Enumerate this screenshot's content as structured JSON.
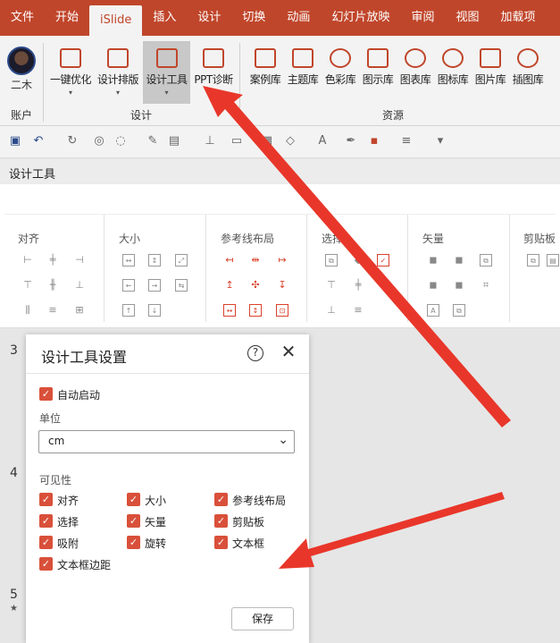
{
  "tabs": [
    "文件",
    "开始",
    "iSlide",
    "插入",
    "设计",
    "切换",
    "动画",
    "幻灯片放映",
    "审阅",
    "视图",
    "加载项"
  ],
  "account": {
    "name": "二木",
    "group_label": "账户"
  },
  "ribbon": {
    "design_items": [
      {
        "label": "一键优化",
        "icon": "monitor-icon"
      },
      {
        "label": "设计排版",
        "icon": "layout-icon"
      },
      {
        "label": "设计工具",
        "icon": "design-tools-icon"
      },
      {
        "label": "PPT诊断",
        "icon": "medkit-icon"
      }
    ],
    "design_group_label": "设计",
    "resource_items": [
      {
        "label": "案例库",
        "icon": "case-icon"
      },
      {
        "label": "主题库",
        "icon": "theme-icon"
      },
      {
        "label": "色彩库",
        "icon": "palette-icon"
      },
      {
        "label": "图示库",
        "icon": "diagram-icon"
      },
      {
        "label": "图表库",
        "icon": "chart-icon"
      },
      {
        "label": "图标库",
        "icon": "icon-library-icon"
      },
      {
        "label": "图片库",
        "icon": "image-icon"
      },
      {
        "label": "插图库",
        "icon": "illustration-icon"
      }
    ],
    "resource_group_label": "资源"
  },
  "pane": {
    "title": "设计工具",
    "groups": [
      "对齐",
      "大小",
      "参考线布局",
      "选择",
      "矢量",
      "剪贴板"
    ]
  },
  "slide_numbers": [
    "3",
    "4",
    "5"
  ],
  "slide_star": "★",
  "dialog": {
    "title": "设计工具设置",
    "help": "?",
    "close": "✕",
    "auto_start": "自动启动",
    "unit_label": "单位",
    "unit_value": "cm",
    "visibility_label": "可见性",
    "options": [
      "对齐",
      "大小",
      "参考线布局",
      "选择",
      "矢量",
      "剪贴板",
      "吸附",
      "旋转",
      "文本框",
      "文本框边距"
    ],
    "save": "保存"
  },
  "colors": {
    "accent": "#c0462b",
    "checkbox": "#d9503a",
    "arrow": "#e8372a"
  }
}
